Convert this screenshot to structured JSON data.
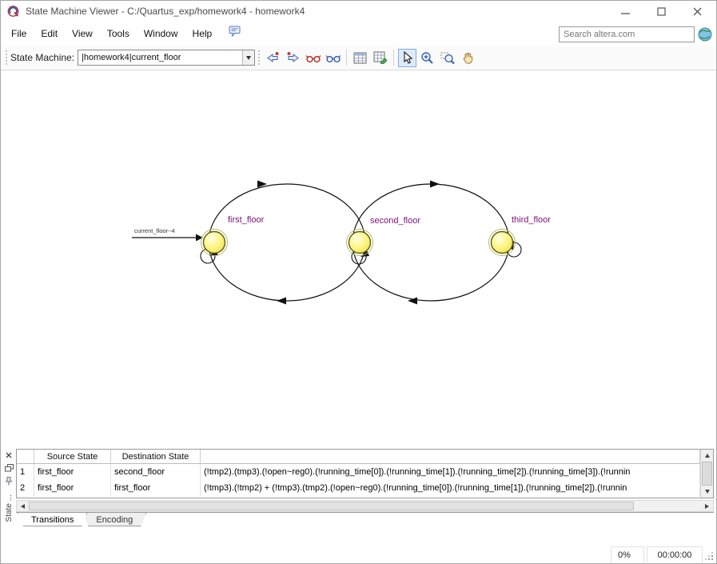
{
  "window": {
    "title": "State Machine Viewer - C:/Quartus_exp/homework4 - homework4"
  },
  "menu": {
    "items": [
      "File",
      "Edit",
      "View",
      "Tools",
      "Window",
      "Help"
    ]
  },
  "search": {
    "placeholder": "Search altera.com"
  },
  "toolbar": {
    "label": "State Machine:",
    "selected_machine": "|homework4|current_floor",
    "buttons": [
      "previous-state-machine",
      "next-state-machine",
      "highlight-fan-in",
      "highlight-fan-out",
      "transition-table",
      "encoding-table",
      "select-tool",
      "zoom-in-tool",
      "zoom-selection-tool",
      "pan-tool"
    ]
  },
  "diagram": {
    "initial_label": "current_floor~4",
    "states": [
      {
        "name": "first_floor"
      },
      {
        "name": "second_floor"
      },
      {
        "name": "third_floor"
      }
    ],
    "colors": {
      "state_fill": "#fdf580",
      "state_stroke": "#5c5c12",
      "state_label": "#7d0f7d",
      "transition": "#111111"
    }
  },
  "table": {
    "headers": [
      "",
      "Source State",
      "Destination State",
      ""
    ],
    "rows": [
      {
        "num": "1",
        "source": "first_floor",
        "dest": "second_floor",
        "condition": "(!tmp2).(tmp3).(!open~reg0).(!running_time[0]).(!running_time[1]).(!running_time[2]).(!running_time[3]).(!runnin"
      },
      {
        "num": "2",
        "source": "first_floor",
        "dest": "first_floor",
        "condition": "(!tmp3).(!tmp2) + (!tmp3).(tmp2).(!open~reg0).(!running_time[0]).(!running_time[1]).(!running_time[2]).(!runnin"
      }
    ]
  },
  "tabs": [
    "Transitions",
    "Encoding"
  ],
  "side_panel": {
    "vertical_label": "State ..."
  },
  "status": {
    "progress": "0%",
    "elapsed": "00:00:00"
  },
  "icons": {
    "names": [
      "quartus-logo-icon",
      "minimize-icon",
      "maximize-icon",
      "close-icon",
      "feedback-icon",
      "globe-icon",
      "dropdown-arrow-icon",
      "scroll-up-icon",
      "scroll-down-icon",
      "scroll-left-icon",
      "scroll-right-icon",
      "float-panel-icon",
      "pin-icon",
      "resize-grip-icon"
    ]
  }
}
